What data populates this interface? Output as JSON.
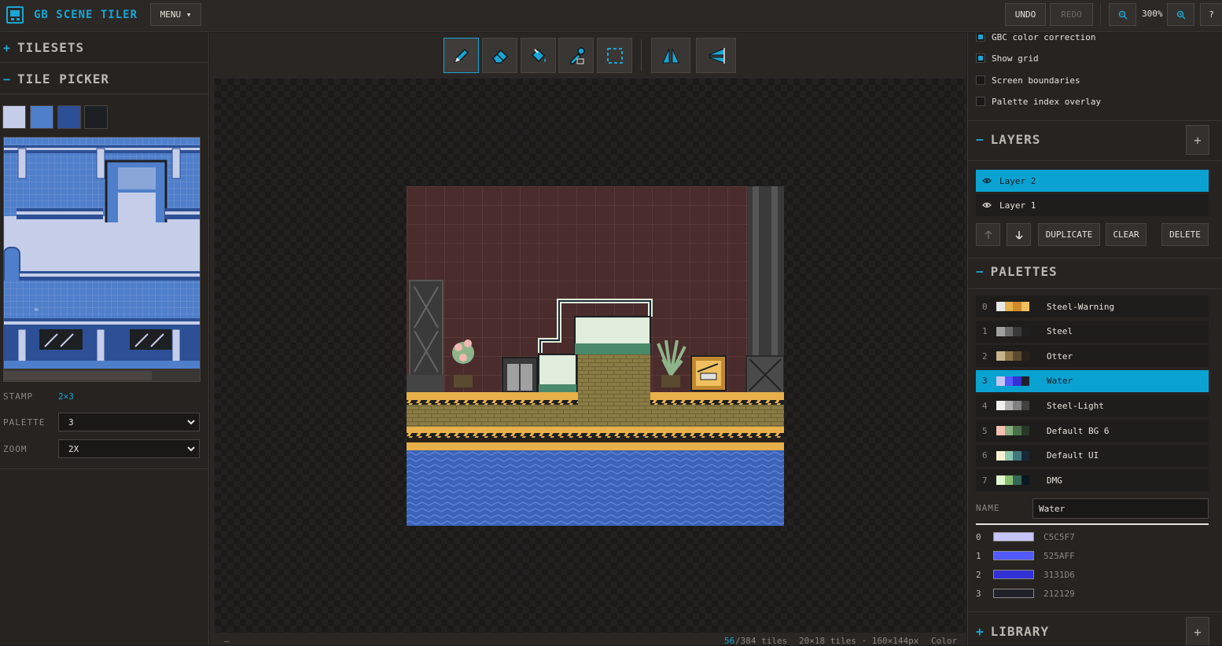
{
  "header": {
    "app_title": "GB SCENE TILER",
    "menu_label": "MENU ▾",
    "undo_label": "UNDO",
    "redo_label": "REDO",
    "zoom_level": "300%",
    "help_label": "?"
  },
  "left_panel": {
    "tilesets_label": "TILESETS",
    "tilesets_toggle": "+",
    "tile_picker_label": "TILE PICKER",
    "tile_picker_toggle": "−",
    "swatch_colors": [
      "#c5cde8",
      "#4f7fca",
      "#2d4f96",
      "#1d1f22"
    ],
    "stamp_label": "STAMP",
    "stamp_value": "2×3",
    "palette_label": "PALETTE",
    "palette_value": "3",
    "zoom_label": "ZOOM",
    "zoom_value": "2X"
  },
  "tools": [
    "pencil-tool",
    "eraser-tool",
    "fill-tool",
    "eyedropper-tool",
    "select-tool",
    "flip-horizontal-tool",
    "flip-vertical-tool"
  ],
  "status": {
    "left": "–",
    "tiles_used": "56",
    "tiles_total": "/384 tiles",
    "dims": "20×18 tiles · 160×144px",
    "mode": "Color"
  },
  "settings": {
    "options": [
      {
        "label": "GBC color correction",
        "checked": true
      },
      {
        "label": "Show grid",
        "checked": true
      },
      {
        "label": "Screen boundaries",
        "checked": false
      },
      {
        "label": "Palette index overlay",
        "checked": false
      }
    ]
  },
  "layers": {
    "title": "LAYERS",
    "toggle": "−",
    "add": "+",
    "items": [
      {
        "name": "Layer 2",
        "active": true
      },
      {
        "name": "Layer 1",
        "active": false
      }
    ],
    "move_up": "🡑",
    "move_down": "🡓",
    "duplicate_label": "DUPLICATE",
    "clear_label": "CLEAR",
    "delete_label": "DELETE"
  },
  "palettes": {
    "title": "PALETTES",
    "toggle": "−",
    "items": [
      {
        "index": "0",
        "name": "Steel-Warning",
        "colors": [
          "#e8e8e8",
          "#e8b04a",
          "#d08a2a",
          "#f0c060"
        ]
      },
      {
        "index": "1",
        "name": "Steel",
        "colors": [
          "#a0a0a0",
          "#6a6a6a",
          "#3a3a3a",
          "#202020"
        ]
      },
      {
        "index": "2",
        "name": "Otter",
        "colors": [
          "#c8b48c",
          "#8c7448",
          "#5a4a30",
          "#2a2218"
        ]
      },
      {
        "index": "3",
        "name": "Water",
        "colors": [
          "#c5c5f7",
          "#525aff",
          "#3131d6",
          "#212129"
        ],
        "active": true
      },
      {
        "index": "4",
        "name": "Steel-Light",
        "colors": [
          "#f0f0f0",
          "#b0b0b0",
          "#808080",
          "#404040"
        ]
      },
      {
        "index": "5",
        "name": "Default BG 6",
        "colors": [
          "#f4c0b0",
          "#88b080",
          "#4a7048",
          "#283828"
        ]
      },
      {
        "index": "6",
        "name": "Default UI",
        "colors": [
          "#f8f0d0",
          "#90c8b0",
          "#407880",
          "#182838"
        ]
      },
      {
        "index": "7",
        "name": "DMG",
        "colors": [
          "#e0f8d0",
          "#88c070",
          "#346856",
          "#081820"
        ]
      }
    ],
    "name_label": "NAME",
    "name_value": "Water",
    "color_rows": [
      {
        "index": "0",
        "hex": "C5C5F7",
        "color": "#c5c5f7"
      },
      {
        "index": "1",
        "hex": "525AFF",
        "color": "#525aff"
      },
      {
        "index": "2",
        "hex": "3131D6",
        "color": "#3131d6"
      },
      {
        "index": "3",
        "hex": "212129",
        "color": "#212129"
      }
    ]
  },
  "library": {
    "title": "LIBRARY",
    "toggle": "+",
    "add": "+"
  }
}
